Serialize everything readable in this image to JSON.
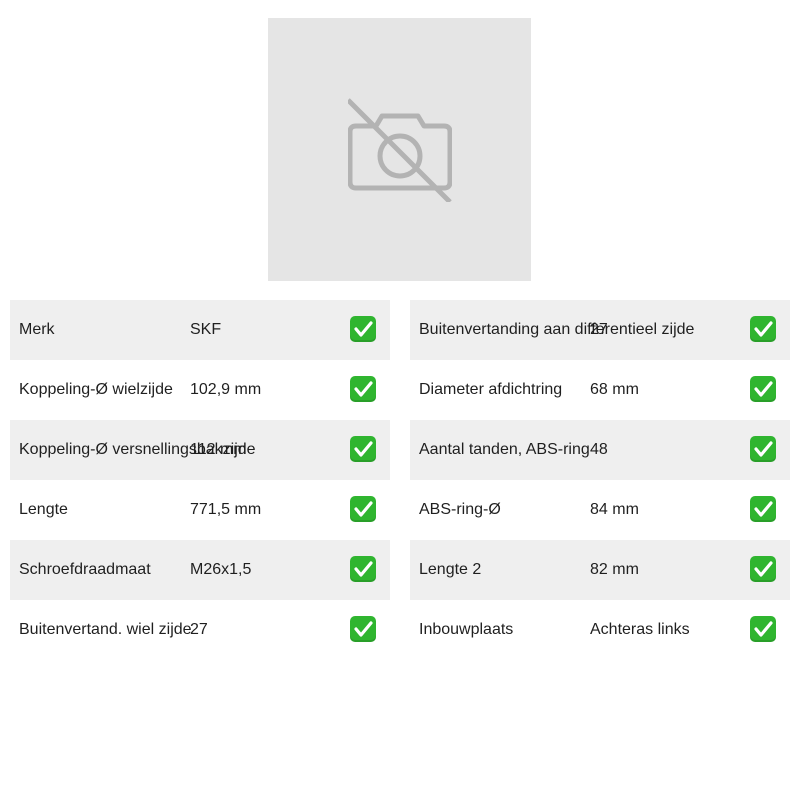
{
  "image": {
    "icon": "camera-off-icon"
  },
  "colors": {
    "row_shade": "#efefef",
    "check": "#2fb52f",
    "placeholder": "#e5e5e5",
    "placeholder_icon": "#b3b3b3"
  },
  "specs_left": [
    {
      "label": "Merk",
      "value": "SKF"
    },
    {
      "label": "Koppeling-Ø wielzijde",
      "value": "102,9 mm"
    },
    {
      "label": "Koppeling-Ø versnellingsbakzijde",
      "value": "112 mm"
    },
    {
      "label": "Lengte",
      "value": "771,5 mm"
    },
    {
      "label": "Schroefdraadmaat",
      "value": "M26x1,5"
    },
    {
      "label": "Buitenvertand. wiel zijde",
      "value": "27"
    }
  ],
  "specs_right": [
    {
      "label": "Buitenvertanding aan differentieel zijde",
      "value": "27"
    },
    {
      "label": "Diameter afdichtring",
      "value": "68 mm"
    },
    {
      "label": "Aantal tanden, ABS-ring",
      "value": "48"
    },
    {
      "label": "ABS-ring-Ø",
      "value": "84 mm"
    },
    {
      "label": "Lengte 2",
      "value": "82 mm"
    },
    {
      "label": "Inbouwplaats",
      "value": "Achteras links"
    }
  ]
}
